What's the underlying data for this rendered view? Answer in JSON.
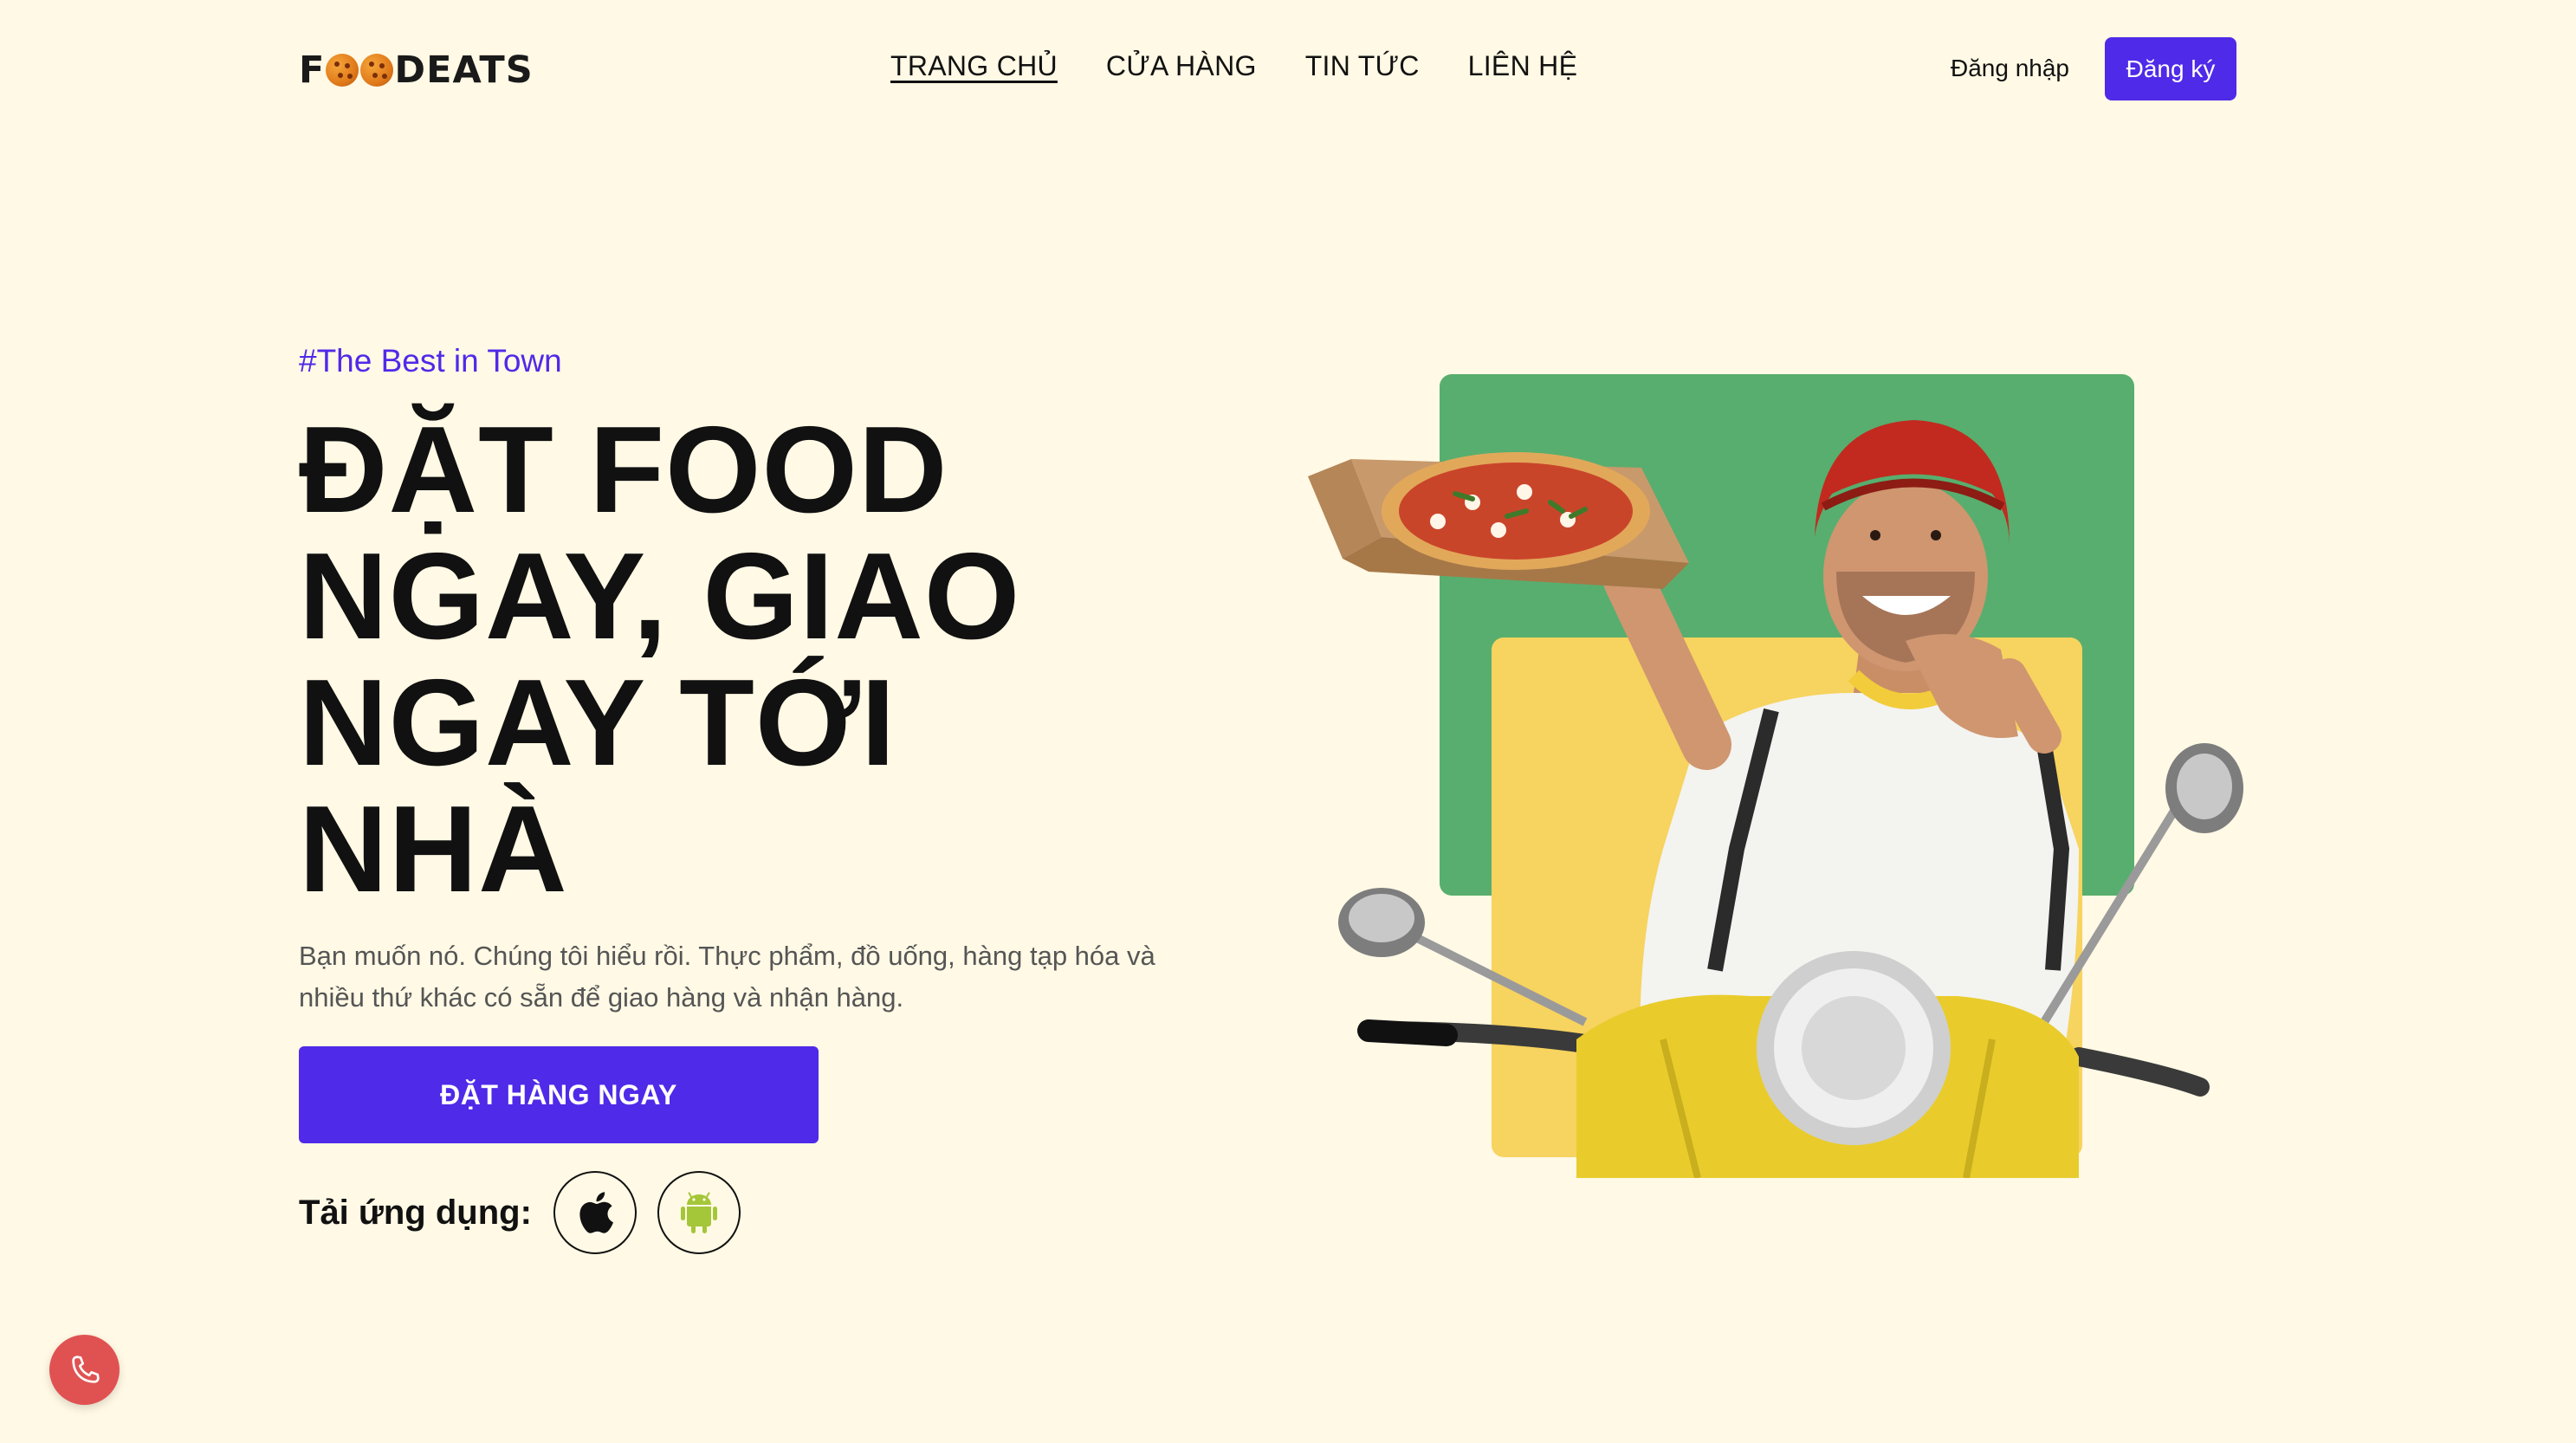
{
  "header": {
    "logo_text_start": "F",
    "logo_text_end": "DEATS",
    "nav": [
      {
        "label": "TRANG CHỦ"
      },
      {
        "label": "CỬA HÀNG"
      },
      {
        "label": "TIN TỨC"
      },
      {
        "label": "LIÊN HỆ"
      }
    ],
    "login_label": "Đăng nhập",
    "signup_label": "Đăng ký"
  },
  "hero": {
    "tag": "#The Best in Town",
    "headline_lines": [
      "ĐẶT FOOD",
      "NGAY, GIAO",
      "NGAY TỚI",
      "NHÀ"
    ],
    "description": "Bạn muốn nó. Chúng tôi hiểu rồi. Thực phẩm, đồ uống, hàng tạp hóa và nhiều thứ khác có sẵn để giao hàng và nhận hàng.",
    "cta_label": "ĐẶT HÀNG NGAY",
    "app_label": "Tải ứng dụng:",
    "app_icons": [
      "apple-icon",
      "android-icon"
    ]
  },
  "colors": {
    "background": "#fff9e5",
    "accent": "#4f2ae8",
    "green_block": "#58ae6e",
    "yellow_block": "#f7d35f",
    "phone_button": "#e05252",
    "android_green": "#a4c639"
  },
  "floating": {
    "icon": "phone-icon"
  }
}
